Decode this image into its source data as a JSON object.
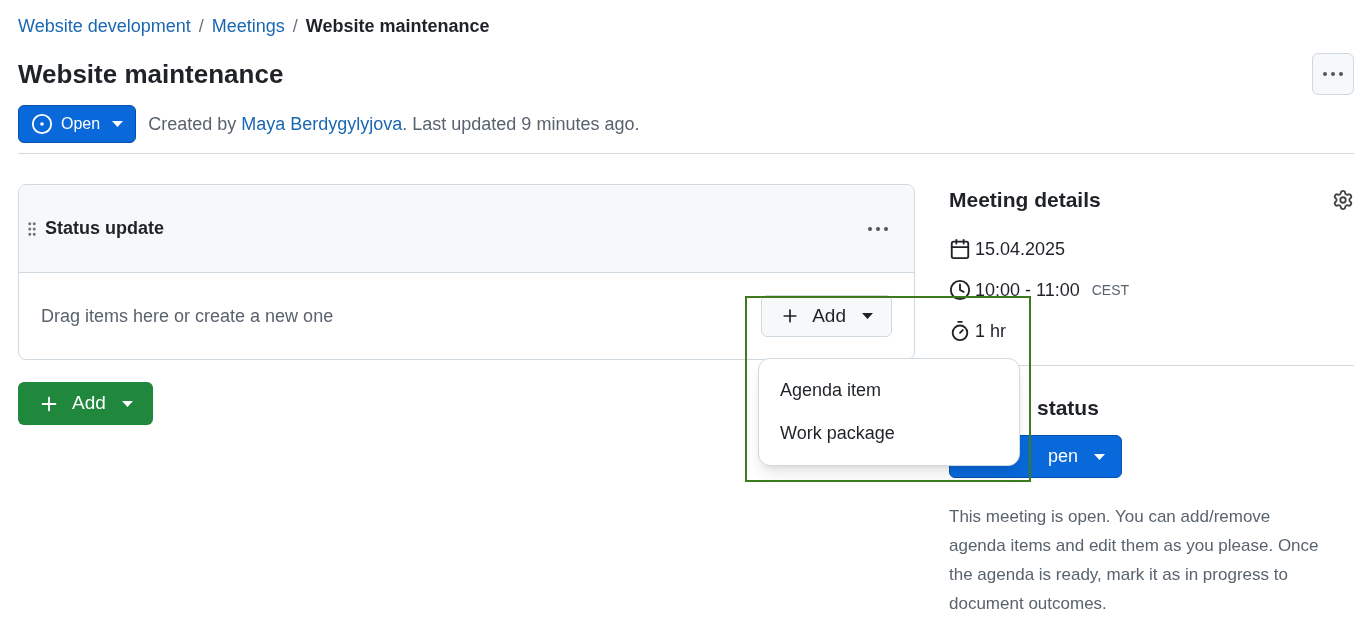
{
  "breadcrumb": [
    {
      "label": "Website development",
      "link": true
    },
    {
      "separator": "/",
      "label": "Meetings",
      "link": true
    },
    {
      "separator": "/",
      "label": "Website maintenance",
      "link": false
    }
  ],
  "title": "Website maintenance",
  "status_button": {
    "label": "Open"
  },
  "created": {
    "prefix": "Created by ",
    "author": "Maya Berdygylyjova",
    "suffix": ". Last updated 9 minutes ago."
  },
  "section": {
    "title": "Status update",
    "empty_text": "Drag items here or create a new one",
    "add_button": "Add"
  },
  "add_button": "Add",
  "menu": {
    "items": [
      "Agenda item",
      "Work package"
    ]
  },
  "details": {
    "title": "Meeting details",
    "date": "15.04.2025",
    "time": "10:00 - 11:00",
    "timezone": "CEST",
    "duration": "1 hr"
  },
  "meeting_status": {
    "title": "status",
    "button": "pen",
    "description": "This meeting is open. You can add/remove agenda items and edit them as you please. Once the agenda is ready, mark it as in progress to document outcomes."
  }
}
